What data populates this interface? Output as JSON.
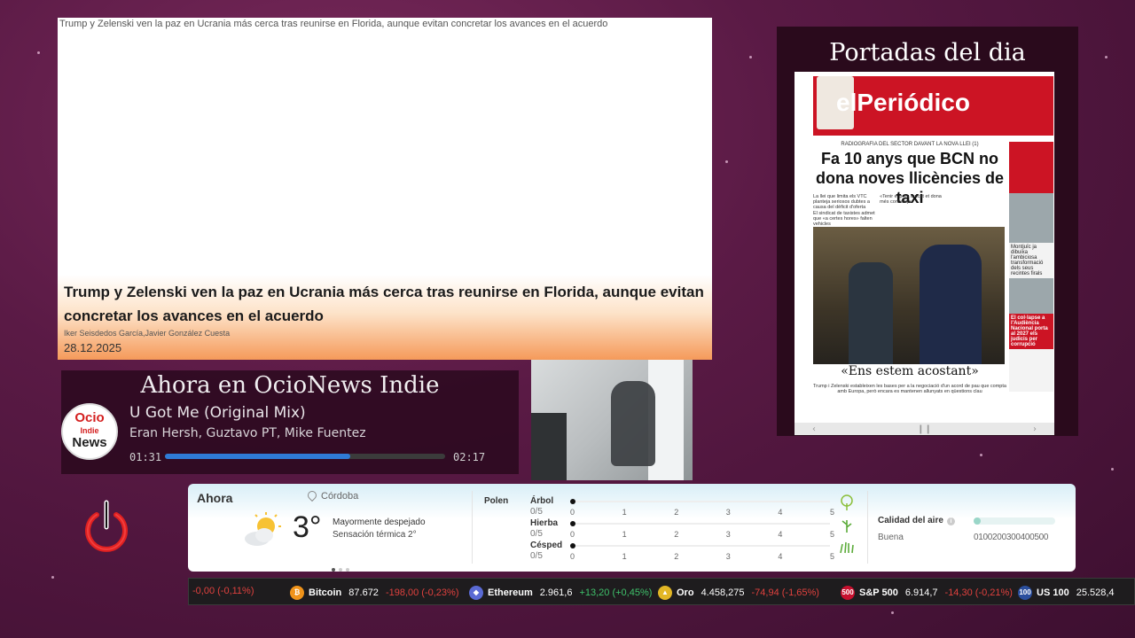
{
  "news": {
    "image_alt": "Trump y Zelenski ven la paz en Ucrania más cerca tras reunirse en Florida, aunque evitan concretar los avances en el acuerdo",
    "title": "Trump y Zelenski ven la paz en Ucrania más cerca tras reunirse en Florida, aunque evitan concretar los avances en el acuerdo",
    "authors": "Iker Seisdedos García,Javier González Cuesta",
    "date": "28.12.2025"
  },
  "player": {
    "heading": "Ahora en OcioNews Indie",
    "logo": {
      "line1": "Ocio",
      "line2": "Indie",
      "line3": "News"
    },
    "track": "U Got Me (Original Mix)",
    "artists": "Eran Hersh, Guztavo PT, Mike Fuentez",
    "elapsed": "01:31",
    "total": "02:17",
    "progress": 0.66
  },
  "portadas": {
    "title": "Portadas del dia",
    "paper": {
      "name": "elPeriódico",
      "kicker": "RADIOGRAFIA DEL SECTOR DAVANT LA NOVA LLEI (1)",
      "headline": "Fa 10 anys que BCN no dona noves llicències de taxi",
      "col1": "La llei que limita els VTC planteja seriosos dubtes a causa del dèficit d'oferta",
      "col2": "«Tenir el preu tancat et dona més confiança»",
      "col3": "El sindicat de taxistes admet que «a certes hores» falten vehicles",
      "side1": "Montjuïc ja dibuixa l'ambiciosa transformació dels seus recintes firals",
      "side2": "El col·lapse a l'Audiència Nacional porta al 2027 els judicis per corrupció",
      "caption": "«Ens estem acostant»",
      "subcaption": "Trump i Zelenski estableixen les bases per a la negociació d'un acord de pau que compta amb Europa, però encara es mantenen allunyats en qüestions clau"
    }
  },
  "weather": {
    "now_label": "Ahora",
    "location": "Córdoba",
    "temperature": "3°",
    "condition": "Mayormente despejado",
    "feels_like": "Sensación térmica 2°",
    "pollen_label": "Polen",
    "pollen": [
      {
        "name": "Árbol",
        "value": "0/5",
        "level": 0
      },
      {
        "name": "Hierba",
        "value": "0/5",
        "level": 0
      },
      {
        "name": "Césped",
        "value": "0/5",
        "level": 0
      }
    ],
    "pollen_ticks": [
      "0",
      "1",
      "2",
      "3",
      "4",
      "5"
    ],
    "air_quality_label": "Calidad del aire",
    "air_quality_value": "Buena",
    "air_quality_scale": "0100200300400500",
    "colors": {
      "accent": "#9ad6c8"
    }
  },
  "ticker": [
    {
      "name": "",
      "price": "",
      "change": "-0,00 (-0,11%)",
      "dir": "neg",
      "icon": "",
      "color": ""
    },
    {
      "name": "Bitcoin",
      "price": "87.672",
      "change": "-198,00 (-0,23%)",
      "dir": "neg",
      "icon": "₿",
      "color": "#f0931a"
    },
    {
      "name": "Ethereum",
      "price": "2.961,6",
      "change": "+13,20 (+0,45%)",
      "dir": "pos",
      "icon": "◆",
      "color": "#5a6ad4"
    },
    {
      "name": "Oro",
      "price": "4.458,275",
      "change": "-74,94 (-1,65%)",
      "dir": "neg",
      "icon": "▲",
      "color": "#e2b625"
    },
    {
      "name": "S&P 500",
      "price": "6.914,7",
      "change": "-14,30 (-0,21%)",
      "dir": "neg",
      "icon": "500",
      "color": "#c8102e"
    },
    {
      "name": "US 100",
      "price": "25.528,4",
      "change": "",
      "dir": "neg",
      "icon": "100",
      "color": "#2b4f9e"
    }
  ]
}
